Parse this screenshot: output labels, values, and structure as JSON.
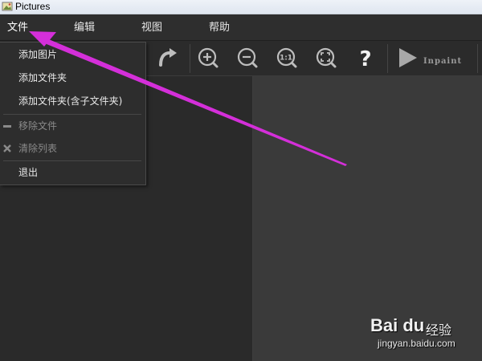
{
  "window": {
    "title": "Pictures"
  },
  "menubar": {
    "items": [
      {
        "label": "文件"
      },
      {
        "label": "编辑"
      },
      {
        "label": "视图"
      },
      {
        "label": "帮助"
      }
    ]
  },
  "toolbar": {
    "tools": [
      "redo-icon",
      "zoom-in-icon",
      "zoom-out-icon",
      "actual-size-icon",
      "fit-to-window-icon",
      "help-icon",
      "play-icon"
    ],
    "inpaint_label": "Inpaint"
  },
  "file_menu": {
    "items": [
      {
        "label": "添加图片",
        "enabled": true
      },
      {
        "label": "添加文件夹",
        "enabled": true
      },
      {
        "label": "添加文件夹(含子文件夹)",
        "enabled": true
      },
      {
        "label": "移除文件",
        "enabled": false,
        "icon": "minus-icon"
      },
      {
        "label": "清除列表",
        "enabled": false,
        "icon": "x-icon"
      },
      {
        "label": "退出",
        "enabled": true
      }
    ]
  },
  "annotation": {
    "color": "#d42fd9"
  },
  "watermark": {
    "logo": "Bai du",
    "brand": "经验",
    "url": "jingyan.baidu.com"
  }
}
